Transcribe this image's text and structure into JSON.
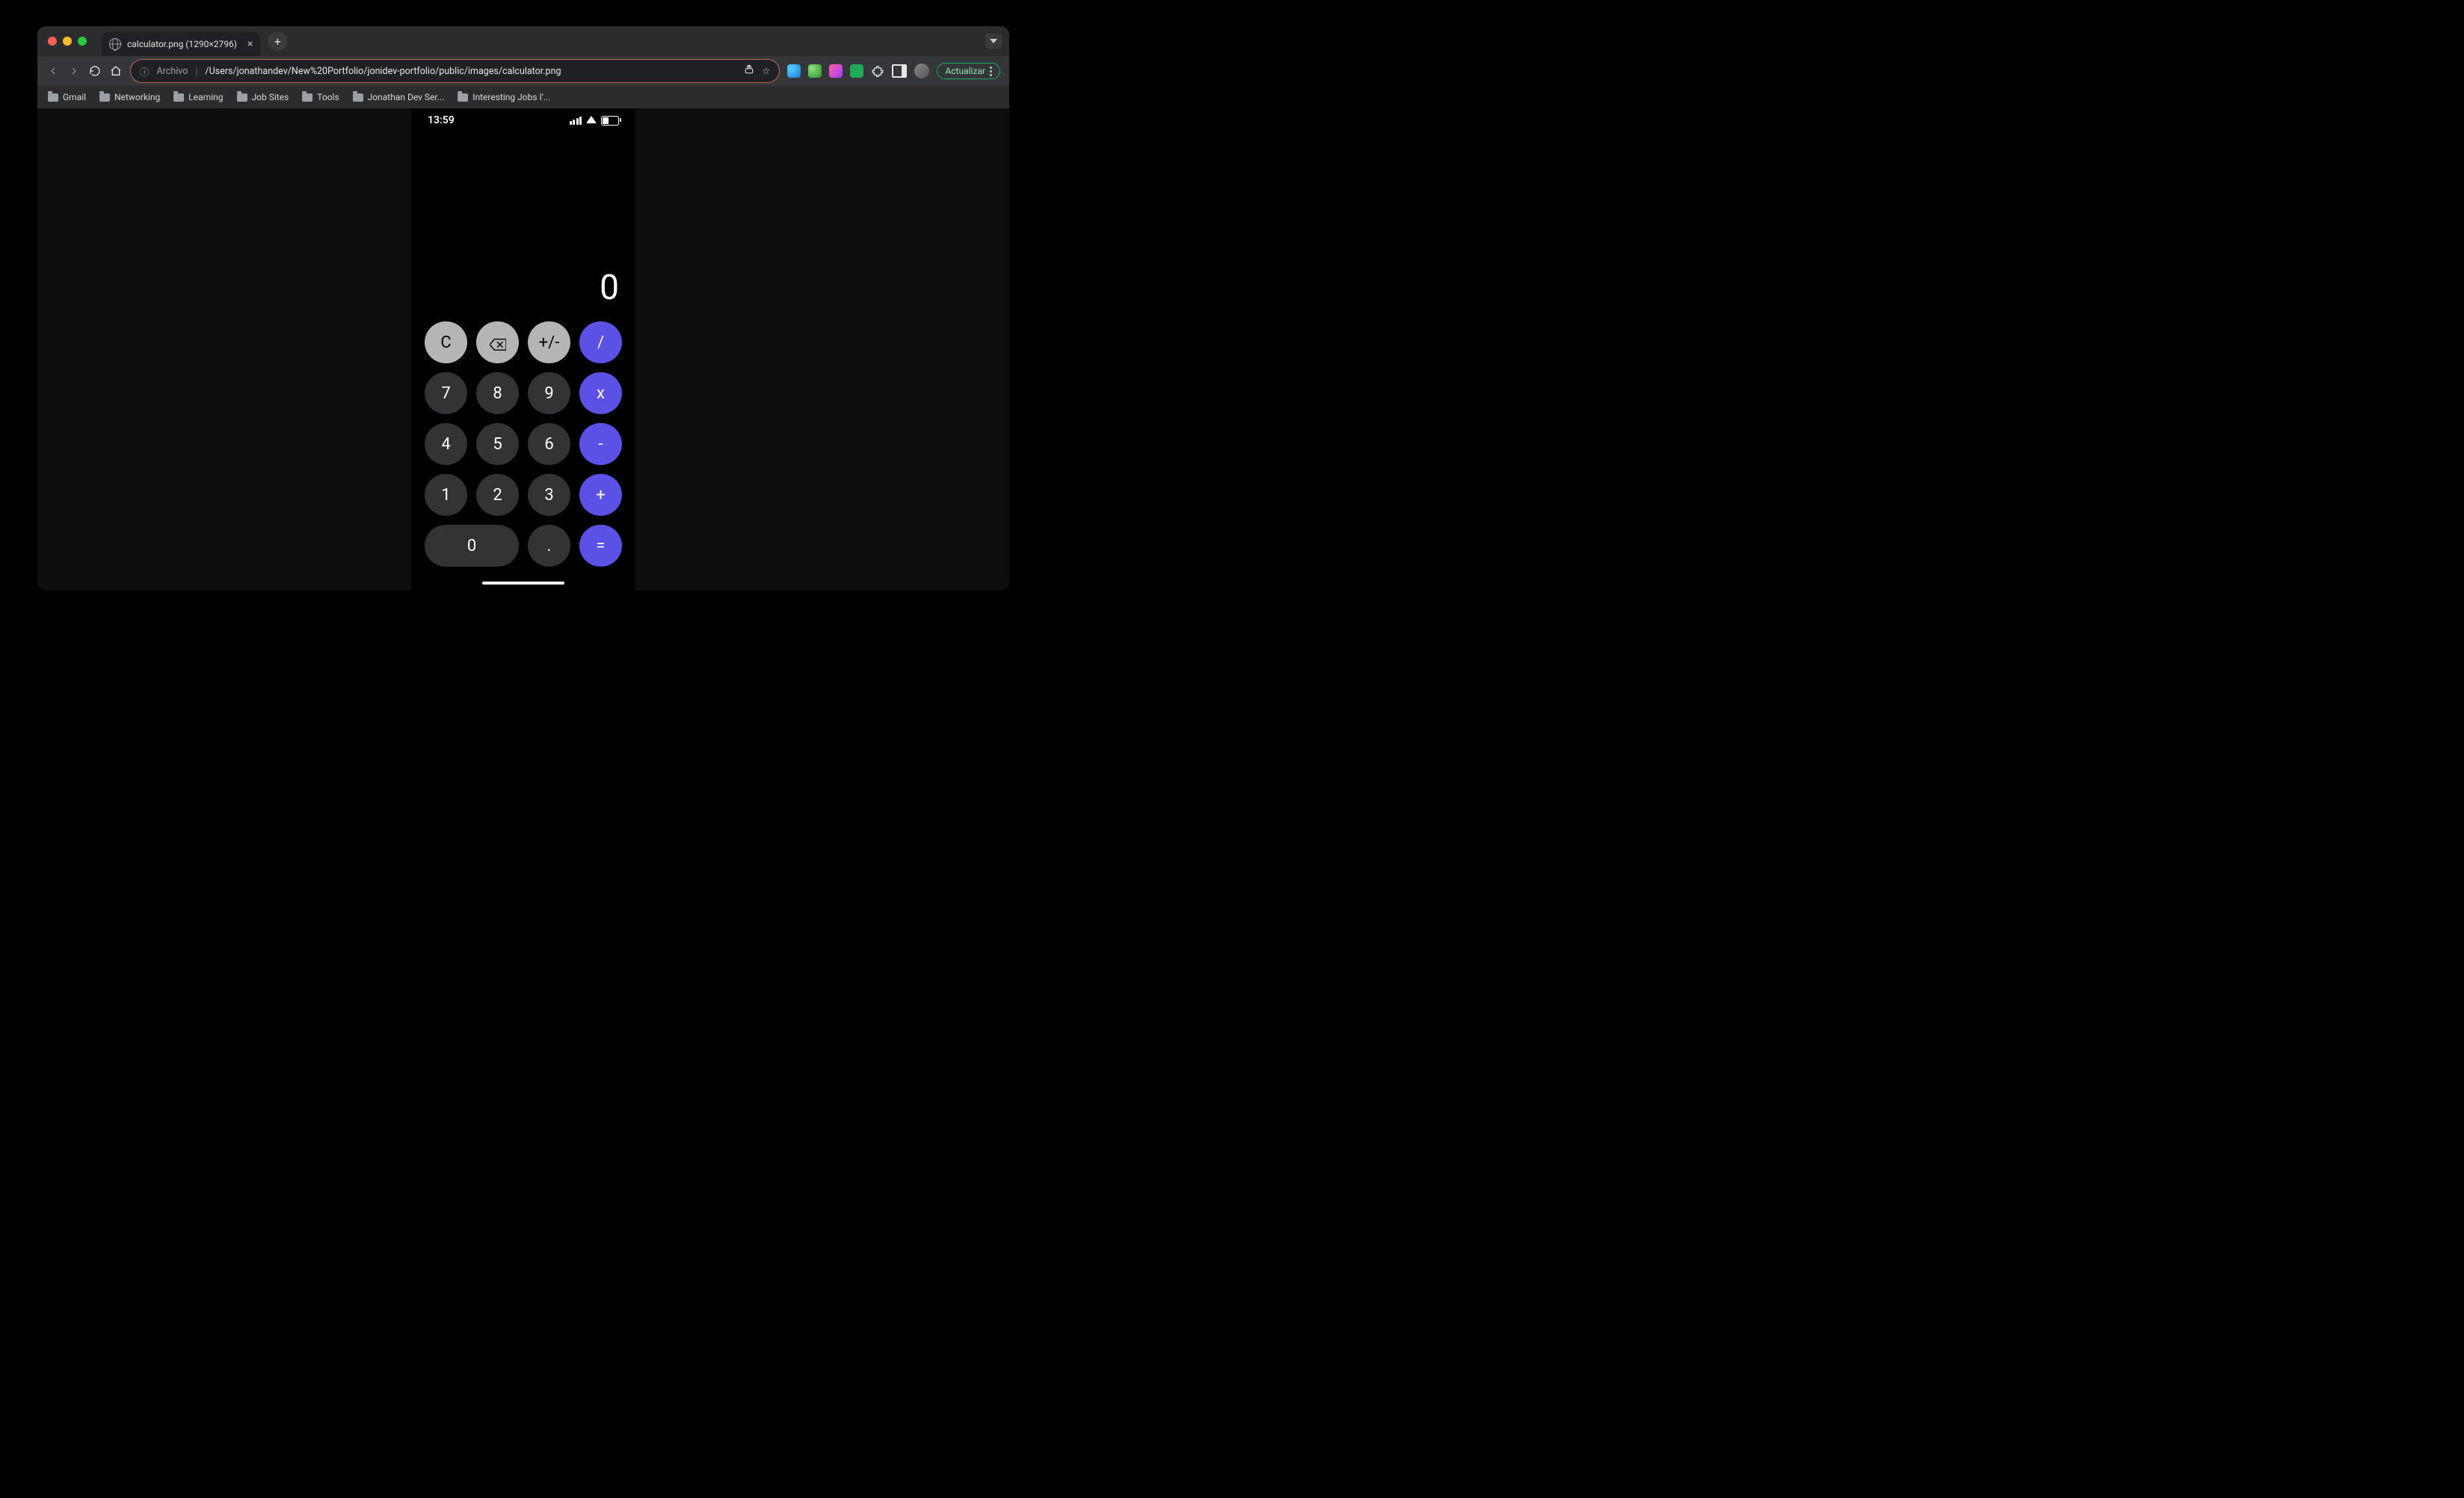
{
  "tab": {
    "title": "calculator.png (1290×2796)"
  },
  "omnibox": {
    "scheme_label": "Archivo",
    "url": "/Users/jonathandev/New%20Portfolio/jonidev-portfolio/public/images/calculator.png"
  },
  "update_button": "Actualizar",
  "bookmarks": [
    "Gmail",
    "Networking",
    "Learning",
    "Job Sites",
    "Tools",
    "Jonathan Dev Ser...",
    "Interesting Jobs I'..."
  ],
  "statusbar": {
    "time": "13:59"
  },
  "calculator": {
    "display": "0",
    "keys": {
      "clear": "C",
      "plusminus": "+/-",
      "divide": "/",
      "k7": "7",
      "k8": "8",
      "k9": "9",
      "multiply": "x",
      "k4": "4",
      "k5": "5",
      "k6": "6",
      "minus": "-",
      "k1": "1",
      "k2": "2",
      "k3": "3",
      "plus": "+",
      "k0": "0",
      "dot": ".",
      "equals": "="
    }
  }
}
